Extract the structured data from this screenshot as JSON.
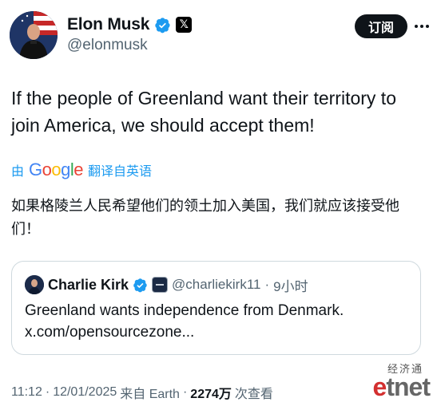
{
  "author": {
    "display_name": "Elon Musk",
    "handle": "@elonmusk",
    "x_badge": "𝕏"
  },
  "header": {
    "subscribe_label": "订阅"
  },
  "tweet": {
    "text": "If the people of Greenland want their territory to join America, we should accept them!"
  },
  "translation": {
    "prefix": "由",
    "provider": "Google",
    "suffix": "翻译自英语",
    "text": "如果格陵兰人民希望他们的领土加入美国，我们就应该接受他们！"
  },
  "quote": {
    "display_name": "Charlie Kirk",
    "handle": "@charliekirk11",
    "separator": "·",
    "time": "9小时",
    "text": "Greenland wants independence from Denmark.",
    "link": "x.com/opensourcezone..."
  },
  "meta": {
    "time": "11:12",
    "sep1": "·",
    "date": "12/01/2025",
    "source": "来自 Earth",
    "sep2": "·",
    "views_count": "2274万",
    "views_label": "次查看"
  },
  "watermark": {
    "chinese": "经济通",
    "logo_e": "e",
    "logo_rest": "tnet"
  },
  "colors": {
    "verified": "#1d9bf0",
    "link": "#1d9bf0",
    "secondary_text": "#536471",
    "primary_text": "#0f1419"
  },
  "icons": {
    "verified": "verified-badge-icon",
    "x_logo": "x-logo-icon",
    "more": "more-options-icon"
  }
}
